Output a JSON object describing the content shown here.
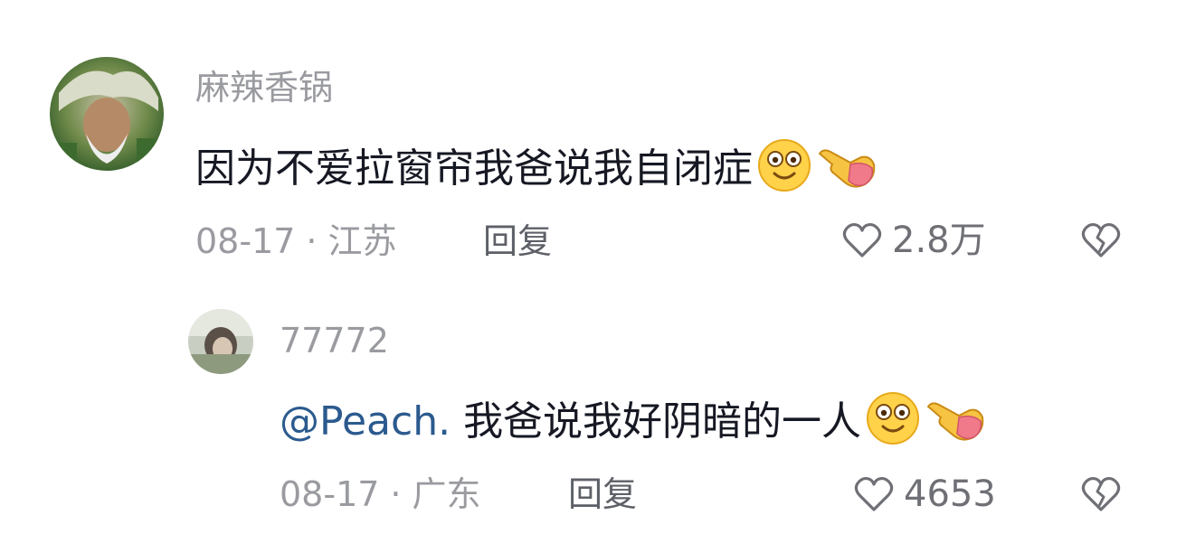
{
  "comments": [
    {
      "username": "麻辣香锅",
      "text": "因为不爱拉窗帘我爸说我自闭症",
      "emojis": [
        "smile-emoji",
        "pointing-finger-emoji"
      ],
      "date": "08-17",
      "separator": "·",
      "location": "江苏",
      "reply_label": "回复",
      "likes": "2.8万"
    }
  ],
  "replies": [
    {
      "username": "77772",
      "mention": "@Peach.",
      "text": "我爸说我好阴暗的一人",
      "emojis": [
        "smile-emoji",
        "pointing-finger-emoji"
      ],
      "date": "08-17",
      "separator": "·",
      "location": "广东",
      "reply_label": "回复",
      "likes": "4653"
    }
  ],
  "icons": {
    "like": "heart-outline-icon",
    "dislike": "broken-heart-icon"
  },
  "colors": {
    "username": "#9a9ba0",
    "mention": "#2b5a8e",
    "text": "#161823",
    "meta": "#9a9ba0",
    "reply": "#5e6068"
  }
}
